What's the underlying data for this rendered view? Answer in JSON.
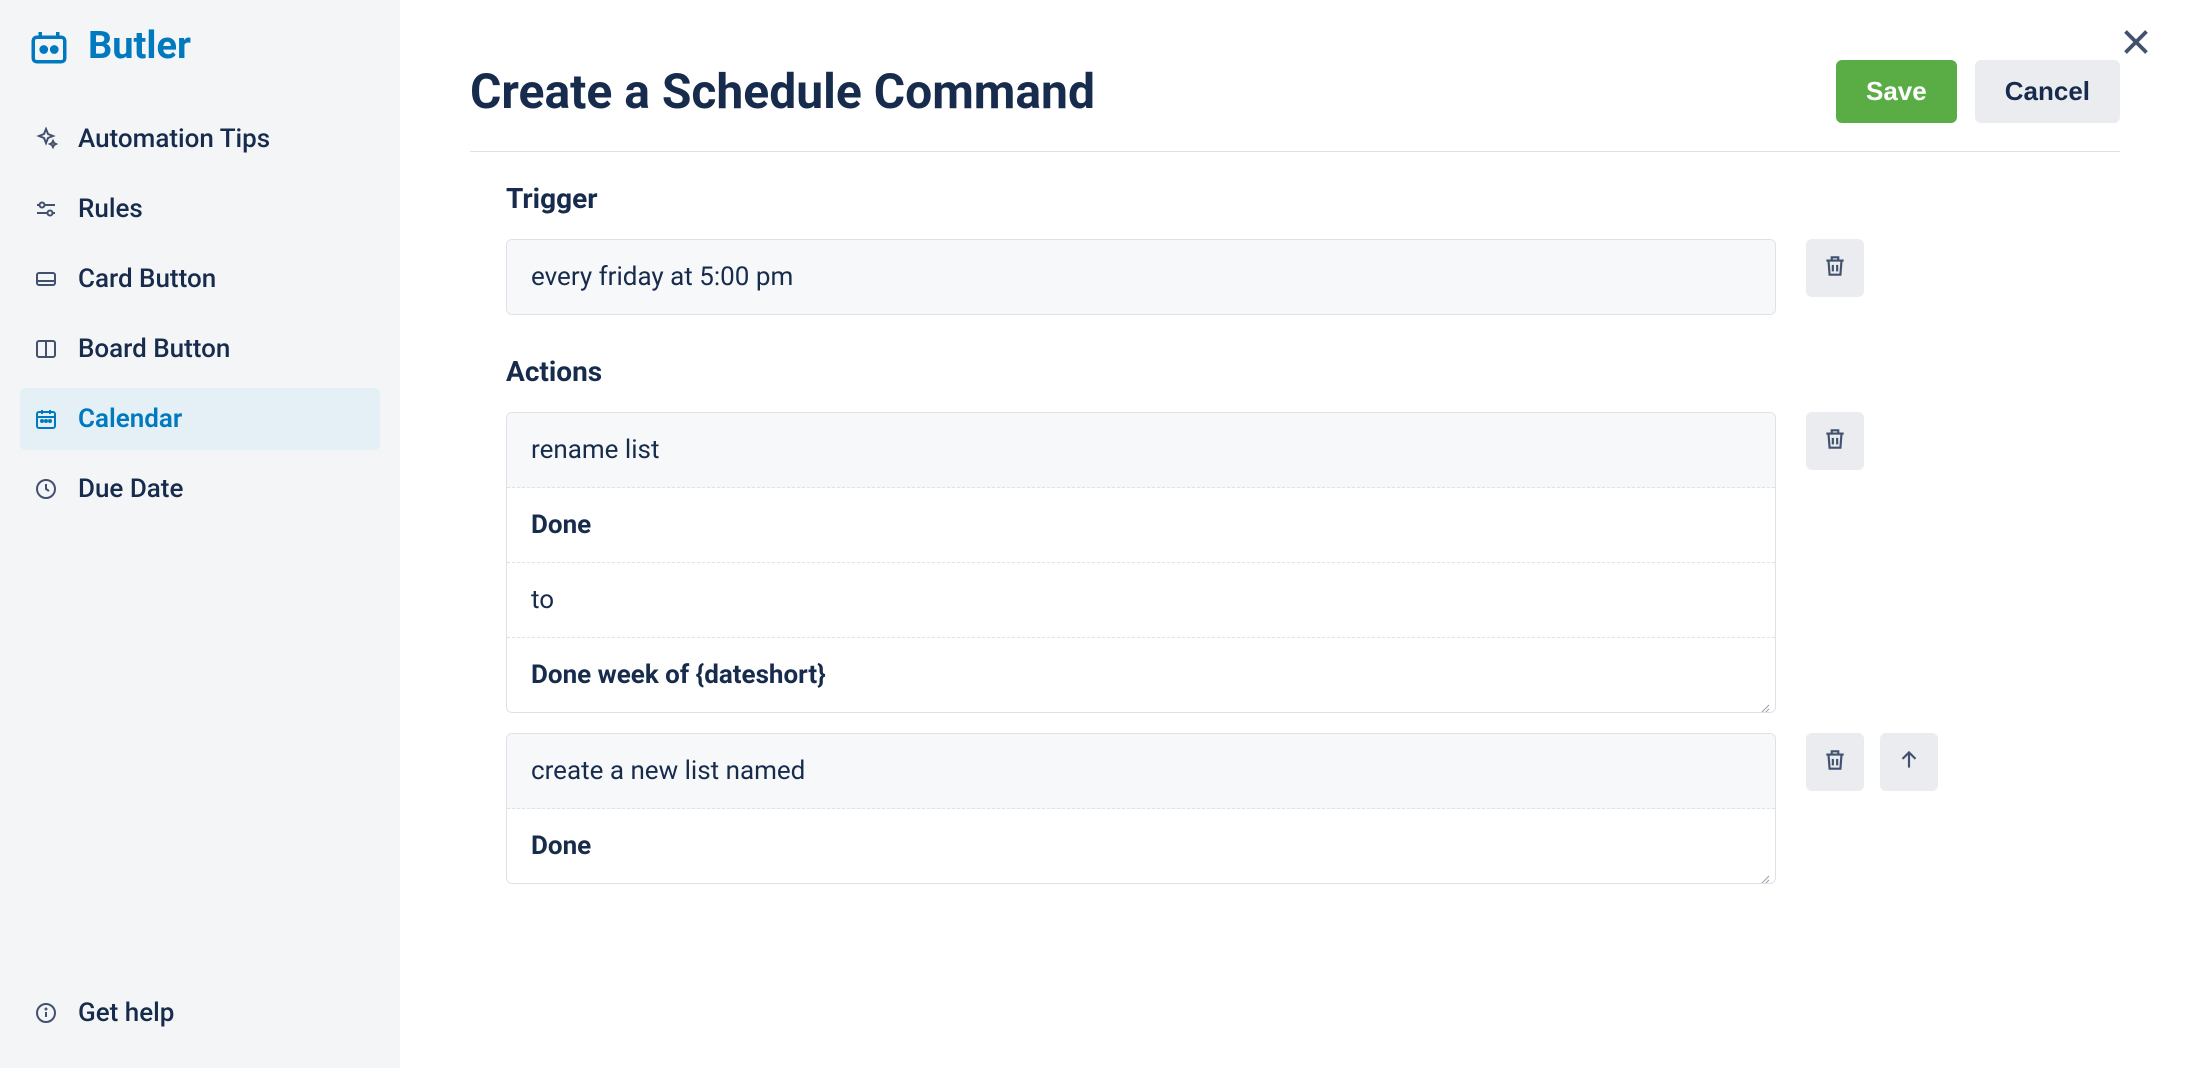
{
  "app": {
    "title": "Butler"
  },
  "sidebar": {
    "items": [
      {
        "label": "Automation Tips",
        "icon": "sparkles-icon",
        "active": false
      },
      {
        "label": "Rules",
        "icon": "sliders-icon",
        "active": false
      },
      {
        "label": "Card Button",
        "icon": "card-icon",
        "active": false
      },
      {
        "label": "Board Button",
        "icon": "board-icon",
        "active": false
      },
      {
        "label": "Calendar",
        "icon": "calendar-icon",
        "active": true
      },
      {
        "label": "Due Date",
        "icon": "clock-icon",
        "active": false
      }
    ],
    "footer": {
      "label": "Get help",
      "icon": "info-icon"
    }
  },
  "header": {
    "title": "Create a Schedule Command",
    "save_label": "Save",
    "cancel_label": "Cancel"
  },
  "trigger": {
    "section_title": "Trigger",
    "text": "every friday at 5:00 pm"
  },
  "actions": {
    "section_title": "Actions",
    "items": [
      {
        "header": "rename list",
        "lines": [
          {
            "text": "Done",
            "bold": true
          },
          {
            "text": "to",
            "bold": false
          },
          {
            "text": "Done week of {dateshort}",
            "bold": true,
            "resizable": true
          }
        ],
        "controls": [
          "trash"
        ]
      },
      {
        "header": "create a new list named",
        "lines": [
          {
            "text": "Done",
            "bold": true,
            "resizable": true
          }
        ],
        "controls": [
          "trash",
          "move-up"
        ]
      }
    ]
  }
}
